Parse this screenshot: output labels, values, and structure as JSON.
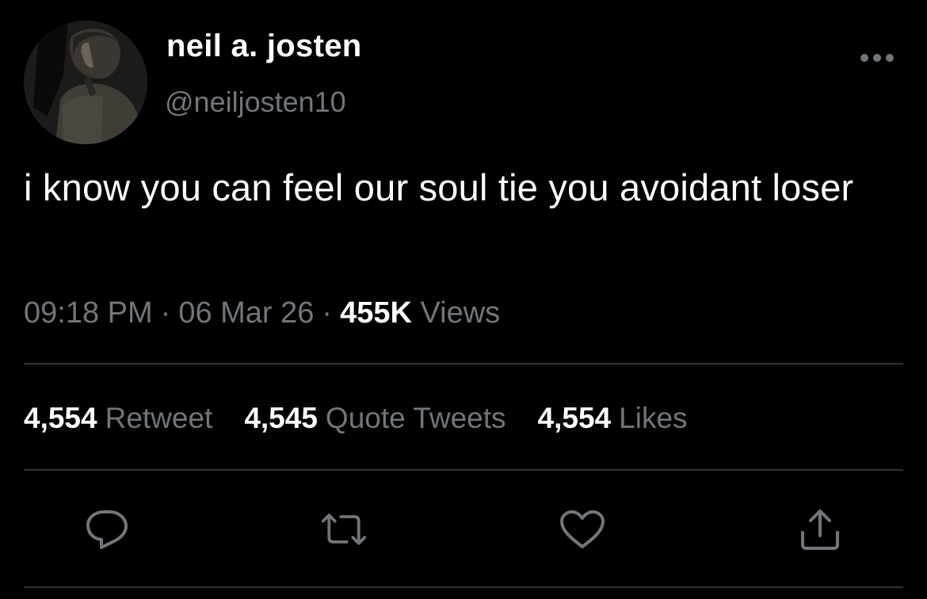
{
  "author": {
    "display_name": "neil a. josten",
    "handle": "@neiljosten10"
  },
  "tweet": {
    "text": "i know you can feel our soul tie you avoidant loser",
    "time": "09:18 PM",
    "date": "06 Mar 26",
    "separator": "·",
    "views_count": "455K",
    "views_label": "Views"
  },
  "stats": {
    "retweets_count": "4,554",
    "retweets_label": "Retweet",
    "quotes_count": "4,545",
    "quotes_label": "Quote Tweets",
    "likes_count": "4,554",
    "likes_label": "Likes"
  },
  "icons": {
    "more": "more-horizontal-icon",
    "reply": "reply-icon",
    "retweet": "retweet-icon",
    "like": "heart-icon",
    "share": "share-icon"
  },
  "colors": {
    "background": "#000000",
    "text_primary": "#ffffff",
    "text_secondary": "#71767b",
    "divider": "#2f3336",
    "icon": "#71767b"
  }
}
